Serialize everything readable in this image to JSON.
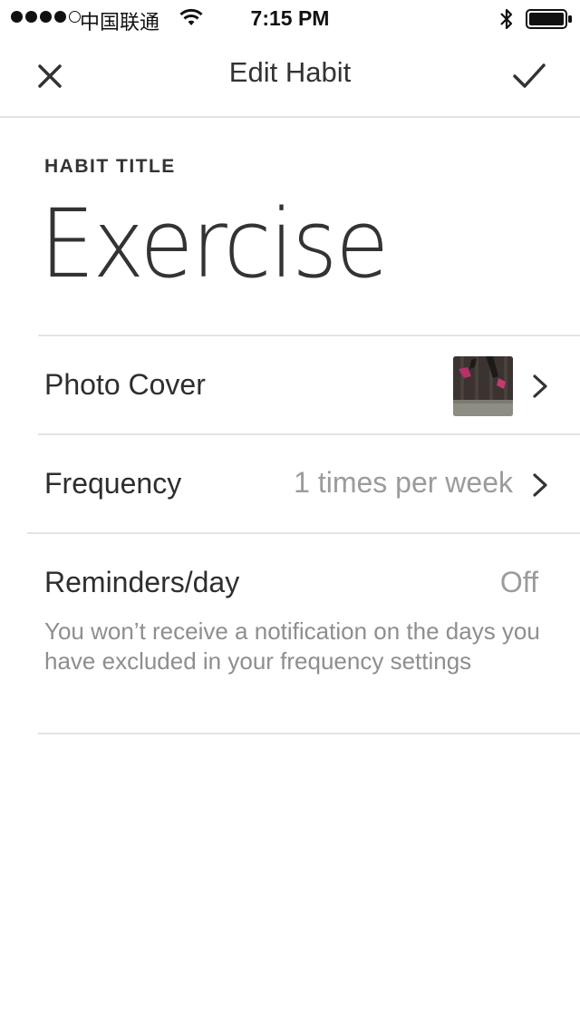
{
  "status_bar": {
    "carrier": "中国联通",
    "time": "7:15 PM"
  },
  "nav": {
    "title": "Edit Habit"
  },
  "habit": {
    "title_label": "HABIT TITLE",
    "title_value": "Exercise"
  },
  "rows": {
    "photo_cover": {
      "label": "Photo Cover"
    },
    "frequency": {
      "label": "Frequency",
      "value": "1 times per week"
    },
    "reminders": {
      "label": "Reminders/day",
      "value": "Off",
      "note": "You won’t receive a notification on the days you have excluded in your frequency settings"
    }
  },
  "colors": {
    "text_primary": "#2e2e2e",
    "text_secondary": "#9b9b9b",
    "divider": "#e4e4e4"
  }
}
